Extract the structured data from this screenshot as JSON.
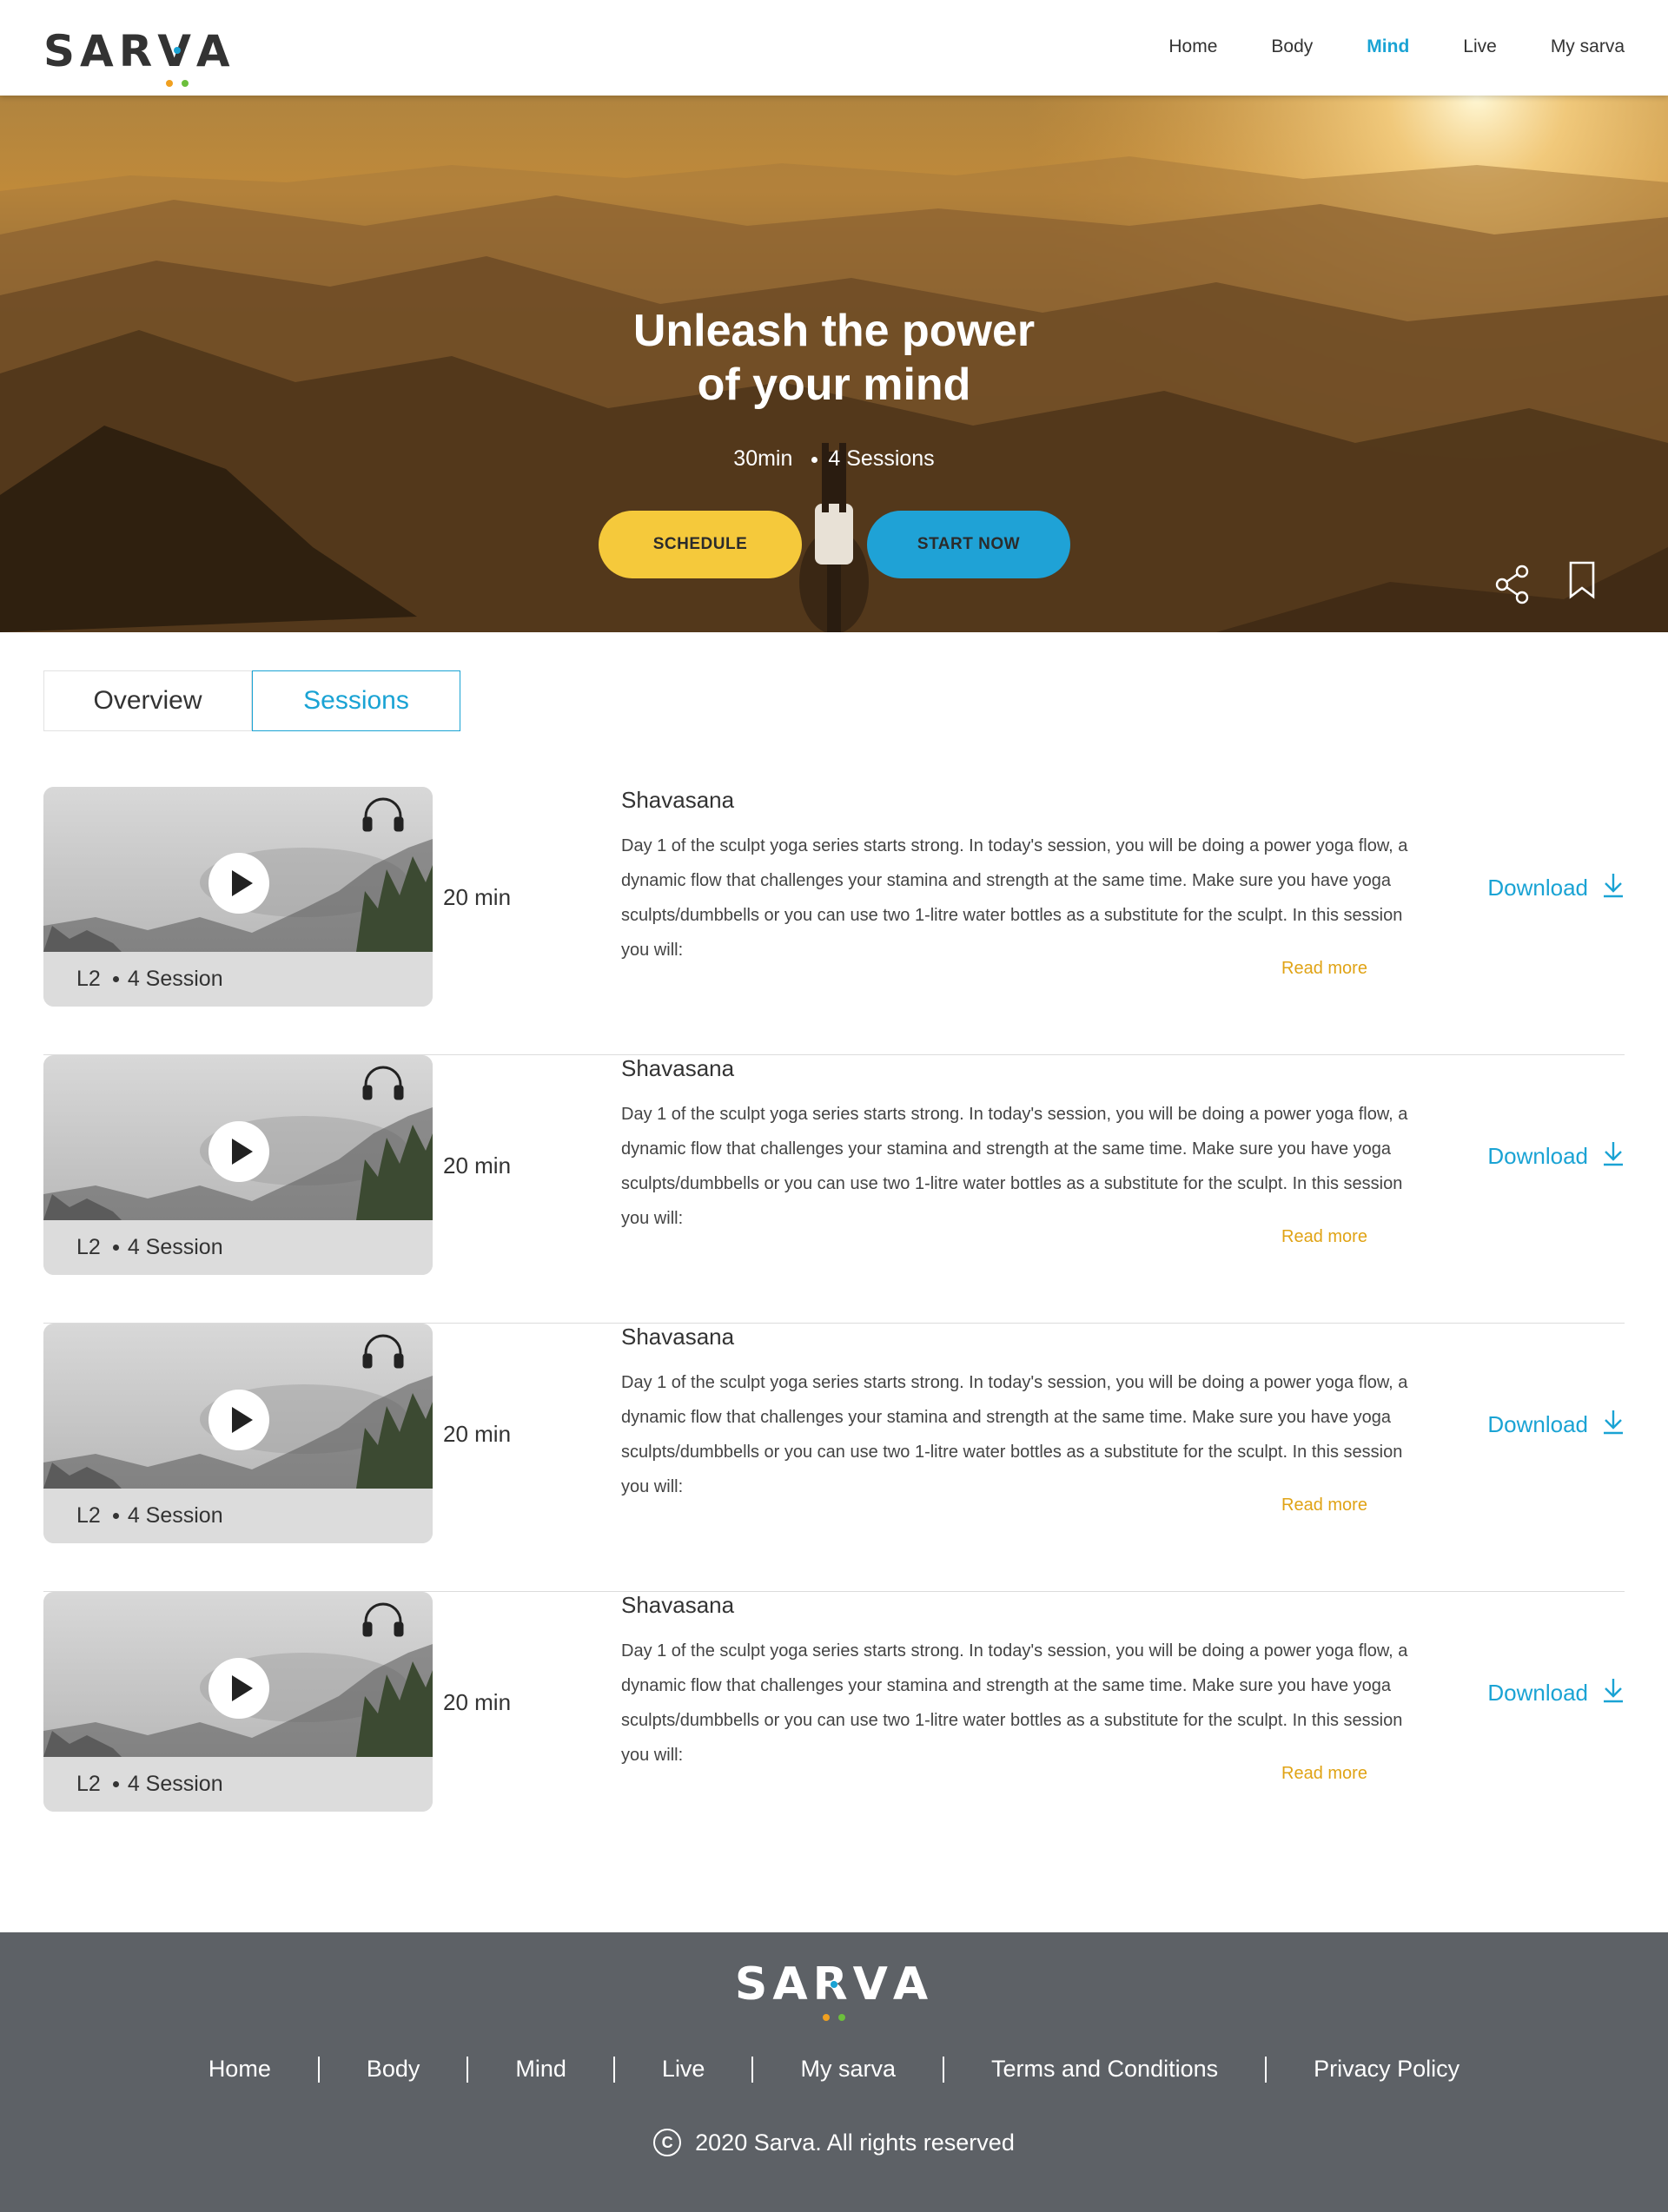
{
  "header": {
    "logo": "SARVA",
    "nav": [
      {
        "label": "Home",
        "active": false
      },
      {
        "label": "Body",
        "active": false
      },
      {
        "label": "Mind",
        "active": true
      },
      {
        "label": "Live",
        "active": false
      },
      {
        "label": "My sarva",
        "active": false
      }
    ]
  },
  "hero": {
    "title_line1": "Unleash the power",
    "title_line2": "of your mind",
    "duration": "30min",
    "sessions": "4 Sessions",
    "schedule_label": "SCHEDULE",
    "start_label": "START NOW",
    "share_icon": "share-icon",
    "bookmark_icon": "bookmark-icon"
  },
  "tabs": [
    {
      "label": "Overview",
      "active": false
    },
    {
      "label": "Sessions",
      "active": true
    }
  ],
  "sessions": [
    {
      "level": "L2",
      "count": "4 Session",
      "duration": "20 min",
      "title": "Shavasana",
      "description": "Day 1 of the sculpt yoga series starts strong. In today's session, you will be doing a power yoga flow, a dynamic flow that challenges your stamina and strength at the same time. Make sure you have yoga sculpts/dumbbells or you can use two 1-litre water bottles as a substitute for the sculpt. In this session you will:",
      "read_more": "Read more",
      "download": "Download"
    },
    {
      "level": "L2",
      "count": "4 Session",
      "duration": "20 min",
      "title": "Shavasana",
      "description": "Day 1 of the sculpt yoga series starts strong. In today's session, you will be doing a power yoga flow, a dynamic flow that challenges your stamina and strength at the same time. Make sure you have yoga sculpts/dumbbells or you can use two 1-litre water bottles as a substitute for the sculpt. In this session you will:",
      "read_more": "Read more",
      "download": "Download"
    },
    {
      "level": "L2",
      "count": "4 Session",
      "duration": "20 min",
      "title": "Shavasana",
      "description": "Day 1 of the sculpt yoga series starts strong. In today's session, you will be doing a power yoga flow, a dynamic flow that challenges your stamina and strength at the same time. Make sure you have yoga sculpts/dumbbells or you can use two 1-litre water bottles as a substitute for the sculpt. In this session you will:",
      "read_more": "Read more",
      "download": "Download"
    },
    {
      "level": "L2",
      "count": "4 Session",
      "duration": "20 min",
      "title": "Shavasana",
      "description": "Day 1 of the sculpt yoga series starts strong. In today's session, you will be doing a power yoga flow, a dynamic flow that challenges your stamina and strength at the same time. Make sure you have yoga sculpts/dumbbells or you can use two 1-litre water bottles as a substitute for the sculpt. In this session you will:",
      "read_more": "Read more",
      "download": "Download"
    }
  ],
  "footer": {
    "logo": "SARVA",
    "links": [
      "Home",
      "Body",
      "Mind",
      "Live",
      "My sarva",
      "Terms and Conditions",
      "Privacy Policy"
    ],
    "copyright": "2020 Sarva. All rights reserved"
  },
  "colors": {
    "accent_blue": "#1aa3d4",
    "accent_yellow": "#f5c93b",
    "read_more": "#e0a315",
    "footer_bg": "#5d6166",
    "logo_dot_orange": "#f0a020",
    "logo_dot_blue": "#1aa3d4",
    "logo_dot_green": "#6cbf3c"
  }
}
